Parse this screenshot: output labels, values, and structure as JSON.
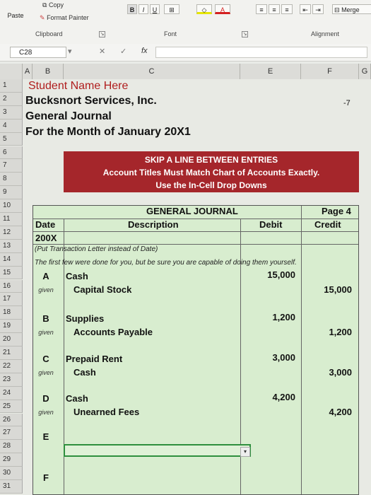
{
  "ribbon": {
    "paste_label": "Paste",
    "copy_label": "Copy",
    "format_painter_label": "Format Painter",
    "bold_label": "B",
    "italic_label": "I",
    "underline_label": "U",
    "merge_label": "Merge",
    "groups": {
      "clipboard": "Clipboard",
      "font": "Font",
      "alignment": "Alignment"
    }
  },
  "formula_bar": {
    "name_box": "C28",
    "fx_label": "fx"
  },
  "columns": [
    "A",
    "B",
    "C",
    "E",
    "F",
    "G"
  ],
  "rows": [
    "1",
    "2",
    "3",
    "4",
    "5",
    "6",
    "7",
    "8",
    "9",
    "10",
    "11",
    "12",
    "13",
    "14",
    "15",
    "16",
    "17",
    "18",
    "19",
    "20",
    "21",
    "22",
    "23",
    "24",
    "25",
    "26",
    "27",
    "28",
    "29",
    "30",
    "31"
  ],
  "sheet": {
    "student_name": "Student Name Here",
    "company": "Bucksnort Services, Inc.",
    "journal_title_line": "General Journal",
    "period": "For the Month of January 20X1",
    "problem_number": "-7"
  },
  "banner": {
    "line1": "SKIP A LINE BETWEEN ENTRIES",
    "line2": "Account Titles Must Match Chart of Accounts Exactly.",
    "line3": "Use the In-Cell Drop Downs"
  },
  "journal": {
    "title": "GENERAL JOURNAL",
    "page": "Page 4",
    "headers": {
      "date": "Date",
      "description": "Description",
      "debit": "Debit",
      "credit": "Credit"
    },
    "year": "200X",
    "note_date": "(Put Transaction Letter instead of Date)",
    "note_done": "The first few were done for you, but be sure you are capable of doing them yourself.",
    "given_label": "given",
    "entries": [
      {
        "letter": "A",
        "debit_account": "Cash",
        "debit_amount": "15,000",
        "credit_account": "Capital Stock",
        "credit_amount": "15,000"
      },
      {
        "letter": "B",
        "debit_account": "Supplies",
        "debit_amount": "1,200",
        "credit_account": "Accounts Payable",
        "credit_amount": "1,200"
      },
      {
        "letter": "C",
        "debit_account": "Prepaid Rent",
        "debit_amount": "3,000",
        "credit_account": "Cash",
        "credit_amount": "3,000"
      },
      {
        "letter": "D",
        "debit_account": "Cash",
        "debit_amount": "4,200",
        "credit_account": "Unearned Fees",
        "credit_amount": "4,200"
      }
    ],
    "pending_letters": [
      "E",
      "F"
    ]
  }
}
